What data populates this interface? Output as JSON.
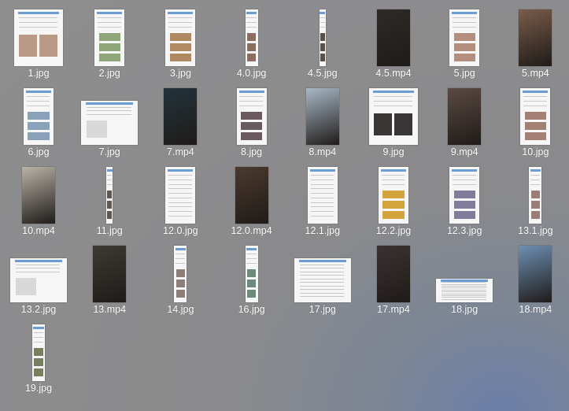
{
  "files": [
    {
      "name": "1.jpg",
      "kind": "doc",
      "tone": "#b99a86"
    },
    {
      "name": "2.jpg",
      "kind": "tall-doc",
      "tone": "#8fa57a"
    },
    {
      "name": "3.jpg",
      "kind": "tall-doc",
      "tone": "#b08a62"
    },
    {
      "name": "4.0.jpg",
      "kind": "strip",
      "tone": "#8c6d61"
    },
    {
      "name": "4.5.jpg",
      "kind": "thin-strip",
      "tone": "#5a5048"
    },
    {
      "name": "4.5.mp4",
      "kind": "video",
      "tone": "#2e2a28"
    },
    {
      "name": "5.jpg",
      "kind": "tall-doc",
      "tone": "#b58d7e"
    },
    {
      "name": "5.mp4",
      "kind": "video",
      "tone": "#7a5c4a"
    },
    {
      "name": "6.jpg",
      "kind": "tall-doc",
      "tone": "#8aa1ba"
    },
    {
      "name": "7.jpg",
      "kind": "wide-doc",
      "tone": "#d8d8d8"
    },
    {
      "name": "7.mp4",
      "kind": "video",
      "tone": "#23333a"
    },
    {
      "name": "8.jpg",
      "kind": "tall-doc",
      "tone": "#6a5a60"
    },
    {
      "name": "8.mp4",
      "kind": "video",
      "tone": "#a9b9c7"
    },
    {
      "name": "9.jpg",
      "kind": "doc",
      "tone": "#3a3535"
    },
    {
      "name": "9.mp4",
      "kind": "video",
      "tone": "#5b4a43"
    },
    {
      "name": "10.jpg",
      "kind": "tall-doc",
      "tone": "#a37f74"
    },
    {
      "name": "10.mp4",
      "kind": "video",
      "tone": "#b9b3a7"
    },
    {
      "name": "11.jpg",
      "kind": "thin-strip",
      "tone": "#615750"
    },
    {
      "name": "12.0.jpg",
      "kind": "tall-text",
      "tone": "#cccccc"
    },
    {
      "name": "12.0.mp4",
      "kind": "video",
      "tone": "#4b3a2e"
    },
    {
      "name": "12.1.jpg",
      "kind": "tall-text",
      "tone": "#9bc59a"
    },
    {
      "name": "12.2.jpg",
      "kind": "tall-doc",
      "tone": "#d3a33c"
    },
    {
      "name": "12.3.jpg",
      "kind": "tall-doc",
      "tone": "#7f7d9a"
    },
    {
      "name": "13.1.jpg",
      "kind": "strip",
      "tone": "#9b7e76"
    },
    {
      "name": "13.2.jpg",
      "kind": "wide-doc",
      "tone": "#d8d8d8"
    },
    {
      "name": "13.mp4",
      "kind": "video",
      "tone": "#3d3a33"
    },
    {
      "name": "14.jpg",
      "kind": "strip",
      "tone": "#8c7f7a"
    },
    {
      "name": "16.jpg",
      "kind": "strip",
      "tone": "#6f8a7d"
    },
    {
      "name": "17.jpg",
      "kind": "wide-text",
      "tone": "#cccccc"
    },
    {
      "name": "17.mp4",
      "kind": "video",
      "tone": "#3b3230"
    },
    {
      "name": "18.jpg",
      "kind": "banner",
      "tone": "#cccccc"
    },
    {
      "name": "18.mp4",
      "kind": "video",
      "tone": "#6e8fb3"
    },
    {
      "name": "19.jpg",
      "kind": "strip",
      "tone": "#77805e"
    }
  ]
}
